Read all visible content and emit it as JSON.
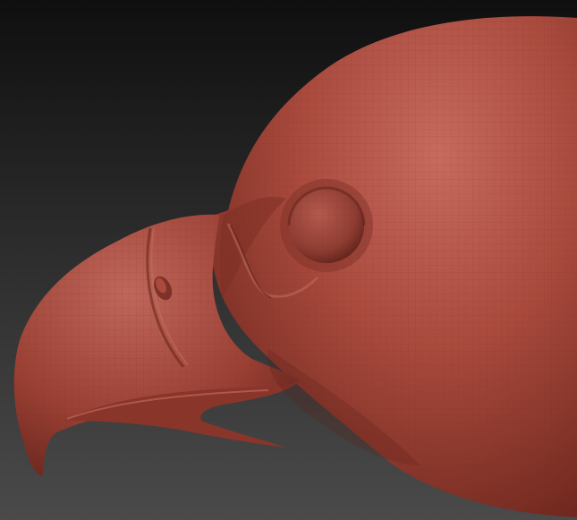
{
  "scene": {
    "subject": "eagle-head-sculpt",
    "colors": {
      "background_top": "#0f0f0f",
      "background_bottom": "#4a4a4a",
      "clay_base": "#9a3f33",
      "clay_highlight": "#c76b5f",
      "clay_shadow": "#5a1f18",
      "eye": "#8e3c32",
      "mesh_line": "#7a2c22"
    }
  }
}
